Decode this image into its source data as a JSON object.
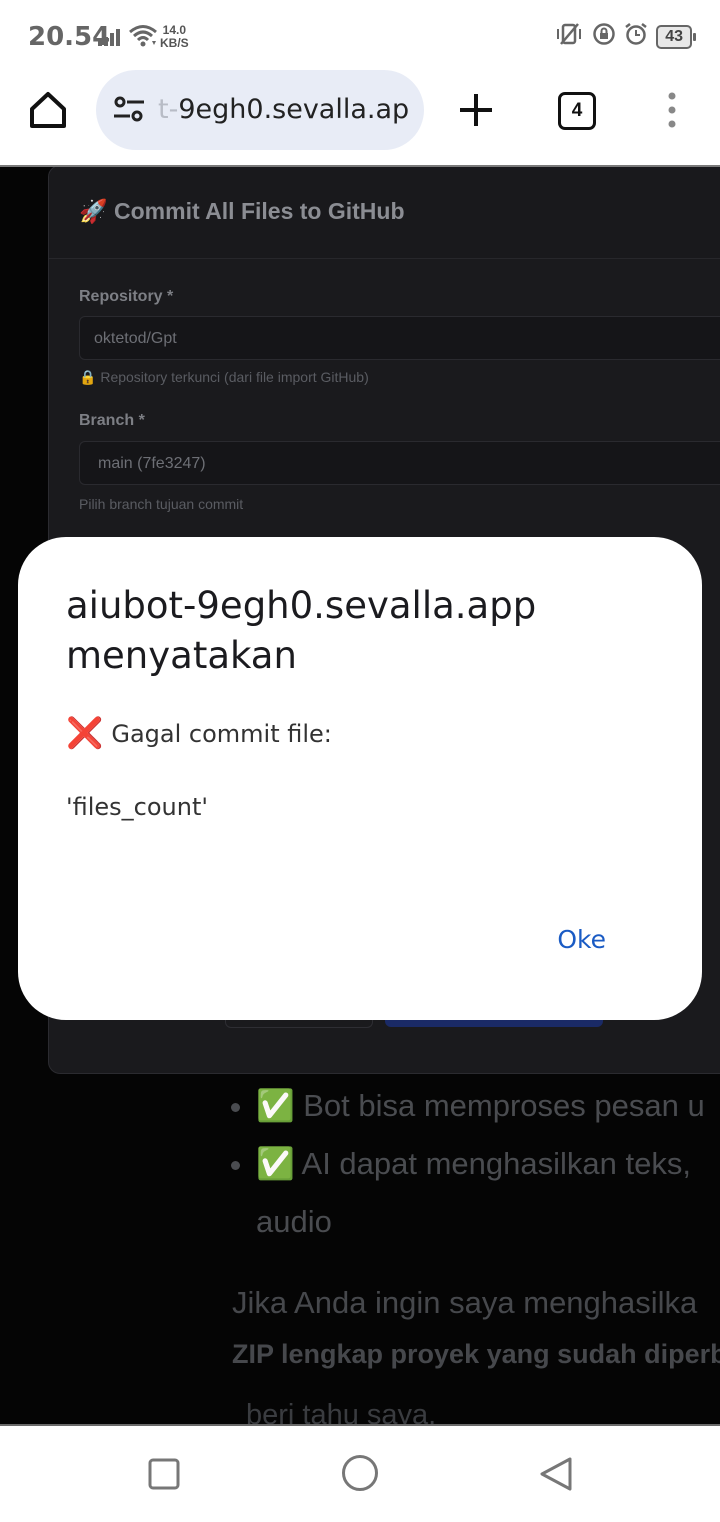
{
  "status_bar": {
    "time": "20.54",
    "speed_value": "14.0",
    "speed_unit": "KB/S",
    "battery": "43",
    "icons": [
      "signal-icon",
      "wifi-icon",
      "vibrate-icon",
      "rotation-lock-icon",
      "alarm-icon",
      "battery-icon"
    ]
  },
  "browser": {
    "url_faded": "t-",
    "url_main": "9egh0.sevalla.app",
    "tab_count": "4"
  },
  "page": {
    "panel_title": "🚀 Commit All Files to GitHub",
    "repository_label": "Repository *",
    "repository_value": "oktetod/Gpt",
    "repository_hint": "Repository terkunci (dari file import GitHub)",
    "branch_label": "Branch *",
    "branch_value": "main (7fe3247)",
    "branch_hint": "Pilih branch tujuan commit",
    "chat_items": [
      "Bot bisa memproses pesan u",
      "AI dapat menghasilkan teks,",
      "audio"
    ],
    "chat_para1": "Jika Anda ingin saya menghasilka",
    "chat_para2": "ZIP lengkap proyek yang sudah diperb",
    "chat_para3": "beri tahu saya."
  },
  "dialog": {
    "title": "aiubot-9egh0.sevalla.app menyatakan",
    "message_line1": "Gagal commit file:",
    "message_line2": "'files_count'",
    "ok_label": "Oke"
  },
  "colors": {
    "accent_link": "#1a5bc4",
    "error_red": "#e0271b",
    "url_bar_bg": "#e8ecf6"
  }
}
